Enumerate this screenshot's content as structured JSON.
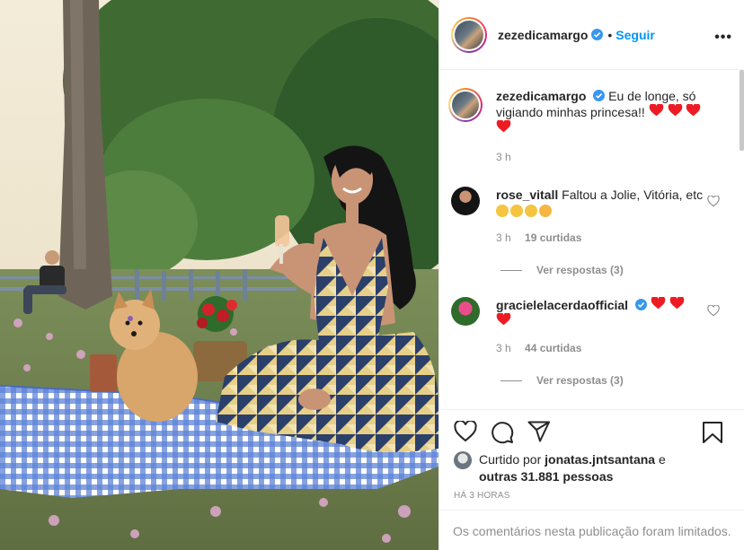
{
  "post": {
    "username": "zezedicamargo",
    "separator": "•",
    "follow_label": "Seguir",
    "more_label": "•••"
  },
  "caption": {
    "username": "zezedicamargo",
    "text": "Eu de longe, só vigiando minhas princesa!!",
    "time": "3 h"
  },
  "comments": [
    {
      "username": "rose_vitall",
      "text": "Faltou a Jolie, Vitória, etc",
      "time": "3 h",
      "likes": "19 curtidas",
      "replies": "Ver respostas (3)"
    },
    {
      "username": "gracielelacerdaofficial",
      "text": "",
      "time": "3 h",
      "likes": "44 curtidas",
      "replies": "Ver respostas (3)"
    }
  ],
  "likes_block": {
    "prefix": "Curtido por",
    "user": "jonatas.jntsantana",
    "conj": "e",
    "others": "outras 31.881 pessoas"
  },
  "time_ago": "HÁ 3 HORAS",
  "comments_limited": "Os comentários nesta publicação foram limitados.",
  "icons": {
    "verified": "verified-badge-icon",
    "heart": "heart-icon",
    "comment": "comment-icon",
    "share": "paper-plane-icon",
    "save": "bookmark-icon",
    "more": "more-options-icon"
  },
  "colors": {
    "link": "#0095f6",
    "verified": "#3897f0",
    "muted": "#8e8e8e",
    "heart_emoji": "#ed1c24"
  }
}
